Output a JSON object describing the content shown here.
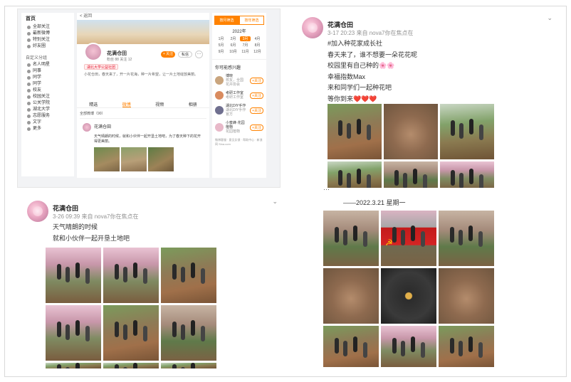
{
  "top_left": {
    "sidebar": {
      "home": "首页",
      "items": [
        "全部关注",
        "最新微博",
        "特别关注",
        "好友圈"
      ],
      "section": "自定义分组",
      "groups": [
        "名人明星",
        "同事",
        "同学",
        "同学",
        "校友",
        "校园关注",
        "公关学院",
        "湖北大学",
        "志愿服务",
        "文字",
        "更多"
      ]
    },
    "profile": {
      "back": "< 返回",
      "name": "花满仓田",
      "stats": "粉丝 88  关注 12",
      "follow_label": "+ 关注",
      "message_label": "私信",
      "more_label": "···",
      "badge": "湖北大学公益社团",
      "desc": "小花仓田，春天来了，开一片花海，种一片希望，让一片土地绽放美丽。",
      "tabs": [
        "精选",
        "微博",
        "视频",
        "相册"
      ],
      "active_tab": 1,
      "all_posts": "全部微博（90）",
      "post_name": "花满仓田",
      "post_text": "天气晴朗的时候，就和小伙伴一起开垦土地吧，为了春天种下的花开得更美丽。"
    },
    "calendar": {
      "tabs": [
        "按月筛选",
        "按年筛选"
      ],
      "year": "2022年",
      "months": [
        "1月",
        "2月",
        "3月",
        "4月",
        "5月",
        "6月",
        "7月",
        "8月",
        "9月",
        "10月",
        "11月",
        "12月"
      ],
      "selected": 2
    },
    "friends": {
      "title": "你可能感兴趣",
      "items": [
        {
          "name": "博晓",
          "desc": "校友，全国 花卉协会",
          "btn": "+关注"
        },
        {
          "name": "考研工作室",
          "desc": "考研工作室",
          "btn": "+关注"
        },
        {
          "name": "湖北DIY手作",
          "desc": "湖北DIY手作官方",
          "btn": "+关注"
        },
        {
          "name": "小蜜蜂·花园植物",
          "desc": "花园植物",
          "btn": "+关注"
        }
      ],
      "footer": "微博客服 · 意见反馈 · 帮助中心 · 新浪网 Sina.com"
    }
  },
  "post_top_right": {
    "name": "花满仓田",
    "meta": "3-17 20:23  来自 nova7你在焦点在",
    "menu": "⌄",
    "lines": [
      "#加入种花家成长社",
      "春天来了，谁不想要一朵花花呢",
      "校园里有自己种的🌸🌸",
      "幸福指数Max",
      "来和同学们一起种花吧",
      "等你到来❤️❤️❤️"
    ]
  },
  "post_bottom_left": {
    "name": "花满仓田",
    "meta": "3-26 09:39  来自 nova7你在焦点在",
    "menu": "⌄",
    "lines": [
      "天气晴朗的时候",
      "就和小伙伴一起开垦土地吧"
    ]
  },
  "post_bottom_right": {
    "cut_text": "···",
    "date_line": "——2022.3.21  星期一"
  },
  "colors": {
    "accent": "#ff8200",
    "frame": "#d9d9d9"
  }
}
